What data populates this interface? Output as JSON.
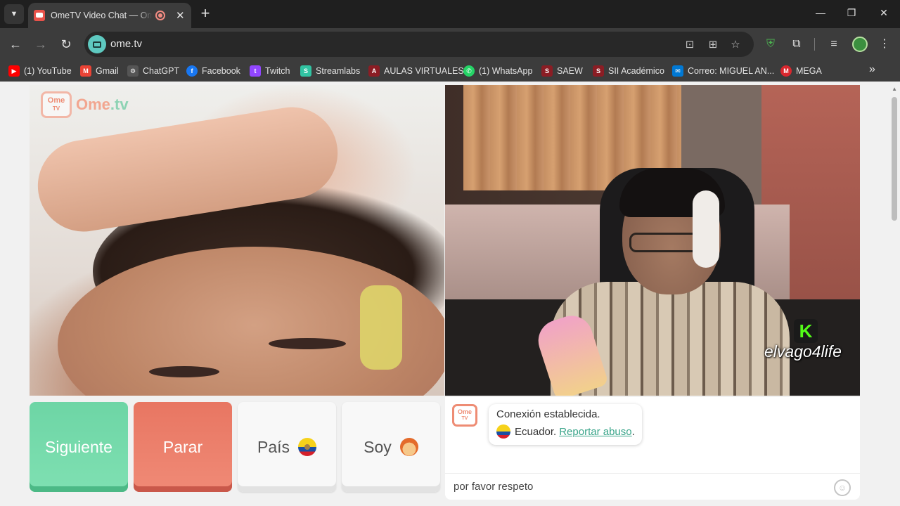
{
  "browser": {
    "tab_title": "OmeTV Video Chat — Omegle",
    "url": "ome.tv",
    "new_tab": "+",
    "tab_close": "✕",
    "minimize": "—",
    "restore": "❐",
    "close": "✕",
    "back": "←",
    "forward": "→",
    "reload": "↻",
    "more_bookmarks": "»"
  },
  "bookmarks": [
    {
      "label": "(1) YouTube",
      "color": "#ff0000",
      "glyph": "▶"
    },
    {
      "label": "Gmail",
      "color": "#ea4335",
      "glyph": "M"
    },
    {
      "label": "ChatGPT",
      "color": "#555555",
      "glyph": "⚙"
    },
    {
      "label": "Facebook",
      "color": "#1877f2",
      "glyph": "f"
    },
    {
      "label": "Twitch",
      "color": "#9146ff",
      "glyph": "t"
    },
    {
      "label": "Streamlabs",
      "color": "#31c3a2",
      "glyph": "S"
    },
    {
      "label": "AULAS VIRTUALES",
      "color": "#8b1d24",
      "glyph": "A"
    },
    {
      "label": "(1) WhatsApp",
      "color": "#25d366",
      "glyph": "✆"
    },
    {
      "label": "SAEW",
      "color": "#8b1d24",
      "glyph": "S"
    },
    {
      "label": "SII Académico",
      "color": "#8b1d24",
      "glyph": "S"
    },
    {
      "label": "Correo: MIGUEL AN...",
      "color": "#0078d4",
      "glyph": "✉"
    },
    {
      "label": "MEGA",
      "color": "#d9272e",
      "glyph": "M"
    }
  ],
  "site": {
    "logo_tv_line1": "Ome",
    "logo_tv_line2": "TV",
    "logo_text_a": "Ome",
    "logo_text_b": ".tv",
    "streamer_name": "elvago4life",
    "streamer_badge": "K"
  },
  "controls": {
    "next": "Siguiente",
    "stop": "Parar",
    "country": "País",
    "gender": "Soy"
  },
  "chat": {
    "line1": "Conexión establecida.",
    "country": "Ecuador.",
    "report": "Reportar abuso",
    "report_suffix": ".",
    "input_value": "por favor respeto"
  }
}
